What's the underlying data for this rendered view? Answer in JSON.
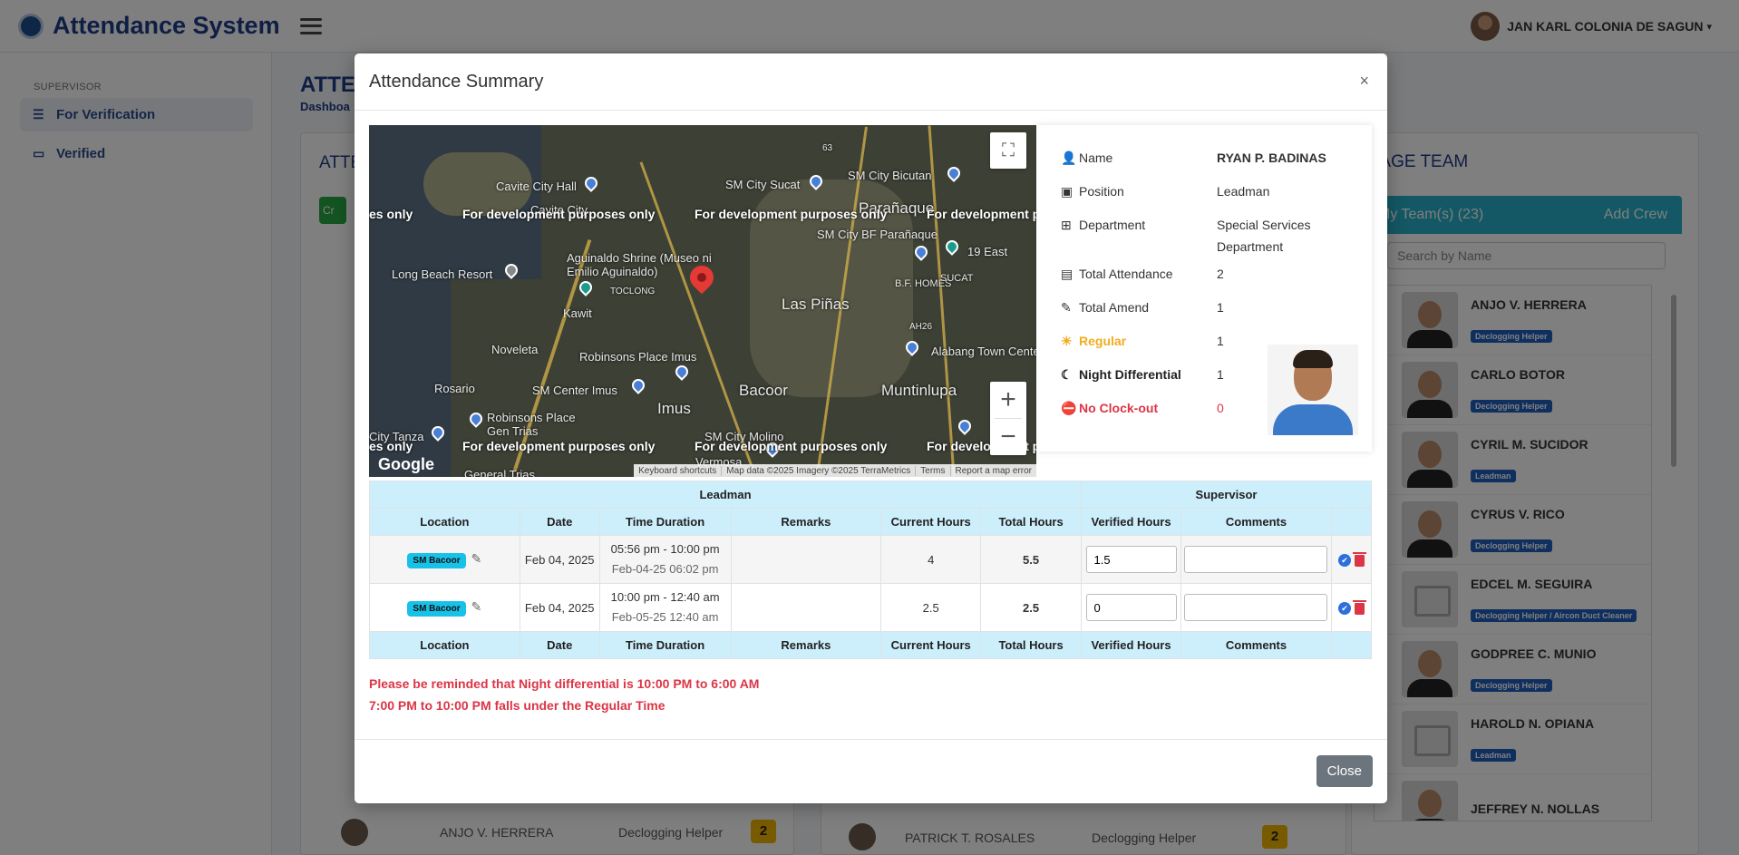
{
  "app": {
    "title": "Attendance System",
    "user_name": "JAN KARL COLONIA DE SAGUN",
    "caret": "▾"
  },
  "sidebar": {
    "section": "SUPERVISOR",
    "items": [
      {
        "label": "For Verification",
        "icon": "list-icon"
      },
      {
        "label": "Verified",
        "icon": "folder-icon"
      }
    ]
  },
  "background": {
    "page_title": "ATTE",
    "breadcrumb": "Dashboa",
    "card_title": "ATTE",
    "create_btn": "Cr",
    "row_left": {
      "name": "ANJO V. HERRERA",
      "role": "Declogging Helper",
      "count": "2"
    },
    "row_mid": {
      "name": "PATRICK T. ROSALES",
      "role": "Declogging Helper",
      "count": "2"
    },
    "manage_team": "ANAGE TEAM",
    "my_teams": "My Team(s) (23)",
    "add_crew": "Add Crew",
    "search_placeholder": "Search by Name",
    "team": [
      {
        "name": "ANJO V. HERRERA",
        "role": "Declogging Helper",
        "photo": "person"
      },
      {
        "name": "CARLO BOTOR",
        "role": "Declogging Helper",
        "photo": "person"
      },
      {
        "name": "CYRIL M. SUCIDOR",
        "role": "Leadman",
        "photo": "person"
      },
      {
        "name": "CYRUS V. RICO",
        "role": "Declogging Helper",
        "photo": "person"
      },
      {
        "name": "EDCEL M. SEGUIRA",
        "role": "Declogging Helper / Aircon Duct Cleaner",
        "photo": "placeholder"
      },
      {
        "name": "GODPREE C. MUNIO",
        "role": "Declogging Helper",
        "photo": "person"
      },
      {
        "name": "HAROLD N. OPIANA",
        "role": "Leadman",
        "photo": "placeholder"
      },
      {
        "name": "JEFFREY N. NOLLAS",
        "role": "",
        "photo": "person"
      }
    ]
  },
  "modal": {
    "title": "Attendance Summary",
    "close_x": "×",
    "map": {
      "watermark": "For development purposes only",
      "watermark_partial_left": "es only",
      "watermark_partial_right": "For development pu",
      "google": "Google",
      "footer": [
        "Keyboard shortcuts",
        "Map data ©2025 Imagery ©2025 TerraMetrics",
        "Terms",
        "Report a map error"
      ],
      "places": {
        "cavite_city_hall": "Cavite City Hall",
        "cavite_city": "Cavite City",
        "sm_sucat": "SM City Sucat",
        "sm_bicutan": "SM City Bicutan",
        "paranaque": "Parañaque",
        "sm_bf": "SM City BF Parañaque",
        "long_beach": "Long Beach Resort",
        "aguinaldo": "Aguinaldo Shrine (Museo ni Emilio Aguinaldo)",
        "toclong": "TOCLONG",
        "bf_homes": "B.F. HOMES",
        "nineteen_east": "19 East",
        "sucat": "SUCAT",
        "kawit": "Kawit",
        "las_pinas": "Las Piñas",
        "noveleta": "Noveleta",
        "robinsons_imus": "Robinsons Place Imus",
        "alabang": "Alabang Town Cente",
        "rosario": "Rosario",
        "sm_center_imus": "SM Center Imus",
        "bacoor": "Bacoor",
        "muntinlupa": "Muntinlupa",
        "robinsons_gen_trias": "Robinsons Place Gen Trias",
        "imus": "Imus",
        "city_tanza": "City Tanza",
        "sm_molino": "SM City Molino",
        "vermosa": "Vermosa",
        "general_trias": "General Trias",
        "road_63": "63",
        "road_ah26": "AH26"
      }
    },
    "info": {
      "name_label": "Name",
      "name_value": "RYAN P. BADINAS",
      "position_label": "Position",
      "position_value": "Leadman",
      "department_label": "Department",
      "department_value": "Special Services Department",
      "total_attendance_label": "Total Attendance",
      "total_attendance_value": "2",
      "total_amend_label": "Total Amend",
      "total_amend_value": "1",
      "regular_label": "Regular",
      "regular_value": "1",
      "night_label": "Night Differential",
      "night_value": "1",
      "noclock_label": "No Clock-out",
      "noclock_value": "0",
      "colors": {
        "regular": "#f0ad1e",
        "no_clock_out": "#dc3545"
      }
    },
    "table": {
      "group_leadman": "Leadman",
      "group_supervisor": "Supervisor",
      "columns": [
        "Location",
        "Date",
        "Time Duration",
        "Remarks",
        "Current Hours",
        "Total Hours",
        "Verified Hours",
        "Comments"
      ],
      "rows": [
        {
          "location": "SM Bacoor",
          "date": "Feb 04, 2025",
          "time": "05:56 pm - 10:00 pm",
          "time_sub": "Feb-04-25 06:02 pm",
          "remarks": "",
          "current": "4",
          "total": "5.5",
          "verified": "1.5",
          "comments": ""
        },
        {
          "location": "SM Bacoor",
          "date": "Feb 04, 2025",
          "time": "10:00 pm - 12:40 am",
          "time_sub": "Feb-05-25 12:40 am",
          "remarks": "",
          "current": "2.5",
          "total": "2.5",
          "verified": "0",
          "comments": ""
        }
      ]
    },
    "reminder_1": "Please be reminded that Night differential is 10:00 PM to 6:00 AM",
    "reminder_2": "7:00 PM to 10:00 PM falls under the Regular Time",
    "close_button": "Close"
  }
}
